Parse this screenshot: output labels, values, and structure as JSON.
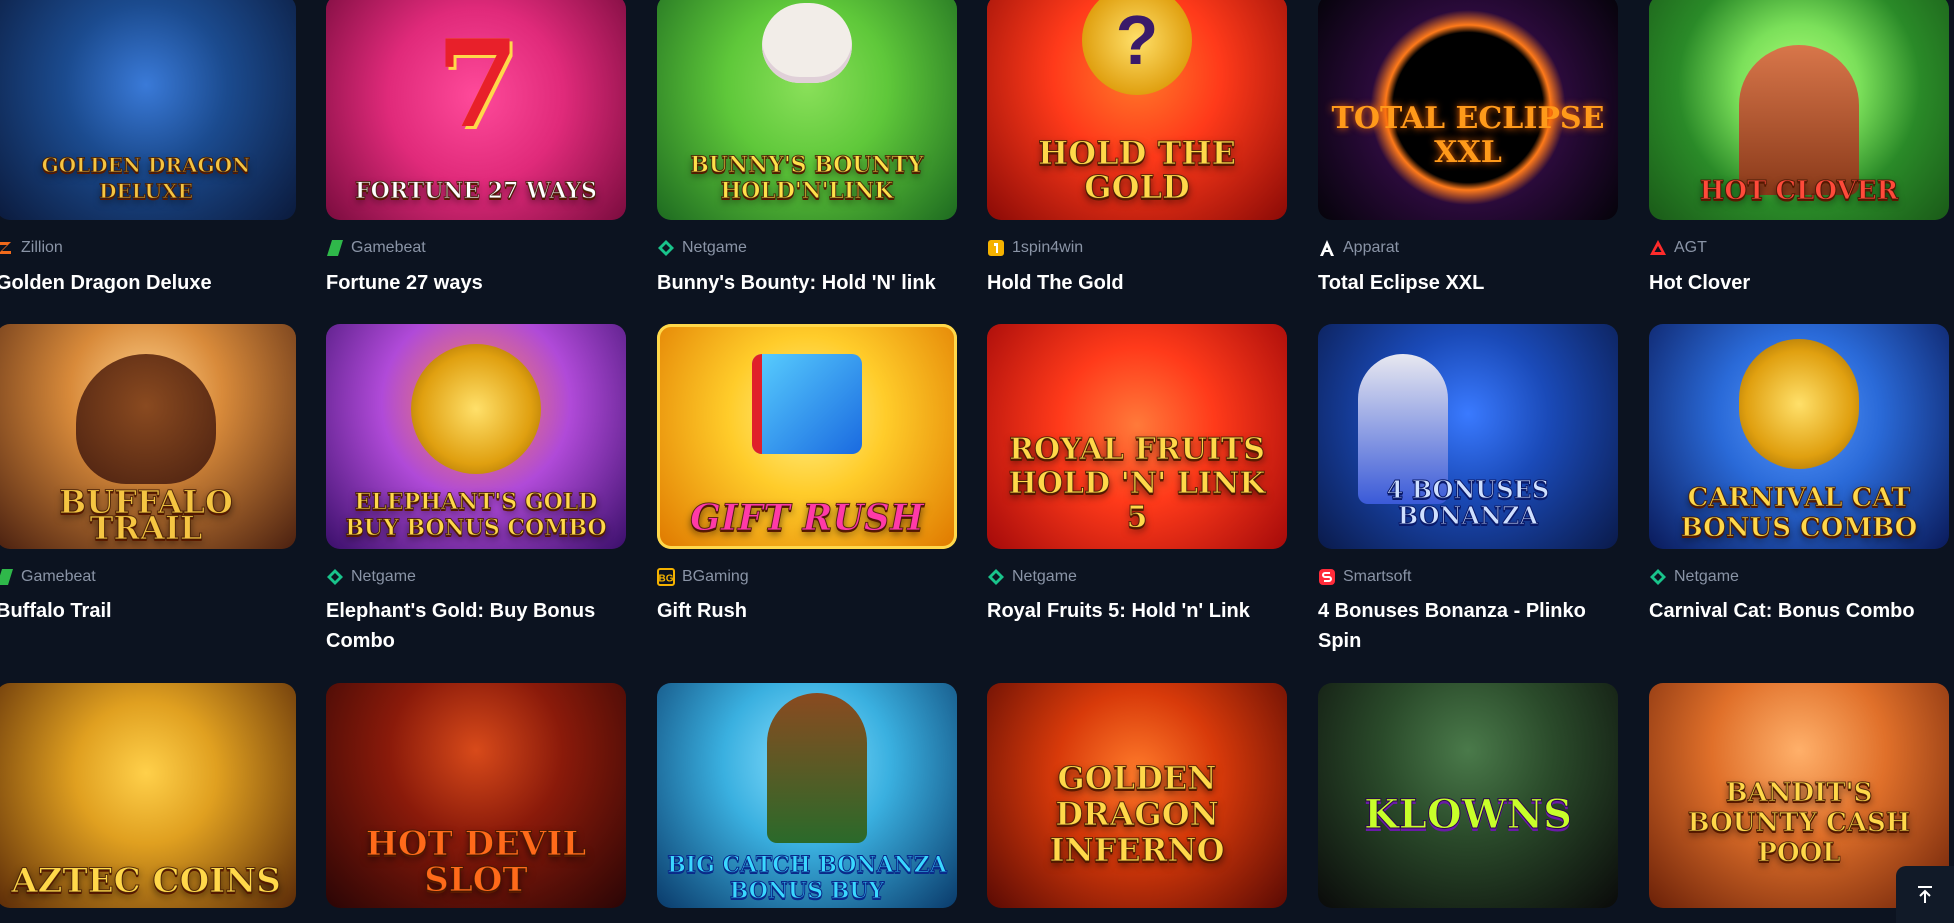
{
  "games": [
    {
      "name": "Golden Dragon Deluxe",
      "provider": "Zillion",
      "provider_icon": "zillion-logo-icon",
      "provider_color": "#f26a1b",
      "art": "golden-dragon-deluxe-artwork",
      "art_text": "GOLDEN DRAGON DELUXE",
      "bg": [
        "#1b4b8f",
        "#0b1a3c"
      ],
      "title_color": "#f5c542"
    },
    {
      "name": "Fortune 27 ways",
      "provider": "Gamebeat",
      "provider_icon": "gamebeat-logo-icon",
      "provider_color": "#2fb84a",
      "art": "fortune-27-ways-artwork",
      "art_text": "FORTUNE 27 WAYS",
      "bg": [
        "#e02a7a",
        "#7a0c3e"
      ],
      "title_color": "#ffffff"
    },
    {
      "name": "Bunny's Bounty: Hold 'N' link",
      "provider": "Netgame",
      "provider_icon": "netgame-logo-icon",
      "provider_color": "#19c48b",
      "art": "bunnys-bounty-artwork",
      "art_text": "BUNNY'S BOUNTY HOLD'N'LINK",
      "bg": [
        "#5fc83a",
        "#1d6a20"
      ],
      "title_color": "#ffe04a"
    },
    {
      "name": "Hold The Gold",
      "provider": "1spin4win",
      "provider_icon": "1spin4win-logo-icon",
      "provider_color": "#f5b200",
      "art": "hold-the-gold-artwork",
      "art_text": "HOLD THE GOLD",
      "bg": [
        "#ff3a1a",
        "#8a0a06"
      ],
      "title_color": "#ffd84a"
    },
    {
      "name": "Total Eclipse XXL",
      "provider": "Apparat",
      "provider_icon": "apparat-logo-icon",
      "provider_color": "#ffffff",
      "art": "total-eclipse-xxl-artwork",
      "art_text": "TOTAL ECLIPSE XXL",
      "bg": [
        "#2a0a3a",
        "#05030a"
      ],
      "title_color": "#ff9a1a"
    },
    {
      "name": "Hot Clover",
      "provider": "AGT",
      "provider_icon": "agt-logo-icon",
      "provider_color": "#ff2b2b",
      "art": "hot-clover-artwork",
      "art_text": "HOT CLOVER",
      "bg": [
        "#7be05a",
        "#1a5a18"
      ],
      "title_color": "#ff4a3a"
    },
    {
      "name": "Buffalo Trail",
      "provider": "Gamebeat",
      "provider_icon": "gamebeat-logo-icon",
      "provider_color": "#2fb84a",
      "art": "buffalo-trail-artwork",
      "art_text": "BUFFALO TRAIL",
      "bg": [
        "#d88a3a",
        "#4a2010"
      ],
      "title_color": "#f5c542"
    },
    {
      "name": "Elephant's Gold: Buy Bonus Combo",
      "provider": "Netgame",
      "provider_icon": "netgame-logo-icon",
      "provider_color": "#19c48b",
      "art": "elephants-gold-artwork",
      "art_text": "ELEPHANT'S GOLD BUY BONUS COMBO",
      "bg": [
        "#b04ad8",
        "#3a0f6a"
      ],
      "title_color": "#ffd84a"
    },
    {
      "name": "Gift Rush",
      "provider": "BGaming",
      "provider_icon": "bgaming-logo-icon",
      "provider_color": "#f5b200",
      "art": "gift-rush-artwork",
      "art_text": "GIFT RUSH",
      "bg": [
        "#ffcc2a",
        "#e07a00"
      ],
      "title_color": "#ff3aa8"
    },
    {
      "name": "Royal Fruits 5: Hold 'n' Link",
      "provider": "Netgame",
      "provider_icon": "netgame-logo-icon",
      "provider_color": "#19c48b",
      "art": "royal-fruits-5-artwork",
      "art_text": "ROYAL FRUITS HOLD 'N' LINK 5",
      "bg": [
        "#ff3a1a",
        "#a40a0a"
      ],
      "title_color": "#ffd84a"
    },
    {
      "name": "4 Bonuses Bonanza - Plinko Spin",
      "provider": "Smartsoft",
      "provider_icon": "smartsoft-logo-icon",
      "provider_color": "#ff2b3a",
      "art": "4-bonuses-bonanza-artwork",
      "art_text": "4 BONUSES BONANZA",
      "bg": [
        "#1a4ab8",
        "#0a1a4a"
      ],
      "title_color": "#cfe0ff"
    },
    {
      "name": "Carnival Cat: Bonus Combo",
      "provider": "Netgame",
      "provider_icon": "netgame-logo-icon",
      "provider_color": "#19c48b",
      "art": "carnival-cat-artwork",
      "art_text": "CARNIVAL CAT BONUS COMBO",
      "bg": [
        "#2a6ad8",
        "#0a1a5a"
      ],
      "title_color": "#ffd84a"
    },
    {
      "art": "aztec-coins-artwork",
      "art_text": "AZTEC COINS",
      "bg": [
        "#e0a020",
        "#5a2a08"
      ],
      "title_color": "#ffd84a"
    },
    {
      "art": "hot-devil-slot-artwork",
      "art_text": "HOT DEVIL SLOT",
      "bg": [
        "#8a1a0a",
        "#2a0505"
      ],
      "title_color": "#ff6a1a"
    },
    {
      "art": "big-catch-bonanza-artwork",
      "art_text": "BIG CATCH BONANZA BONUS BUY",
      "bg": [
        "#3ab0e0",
        "#0a3a6a"
      ],
      "title_color": "#3ad8ff"
    },
    {
      "art": "golden-dragon-inferno-artwork",
      "art_text": "GOLDEN DRAGON INFERNO",
      "bg": [
        "#d83a0a",
        "#5a0a04"
      ],
      "title_color": "#ffd84a"
    },
    {
      "art": "klowns-artwork",
      "art_text": "KLOWNS",
      "bg": [
        "#2a4a2a",
        "#0a0a0a"
      ],
      "title_color": "#c8ff2a"
    },
    {
      "art": "bandits-bounty-cash-pool-artwork",
      "art_text": "BANDIT'S BOUNTY CASH POOL",
      "bg": [
        "#e0702a",
        "#6a2008"
      ],
      "title_color": "#ffd84a"
    }
  ],
  "scroll_top": {
    "icon": "arrow-up-to-top-icon"
  }
}
